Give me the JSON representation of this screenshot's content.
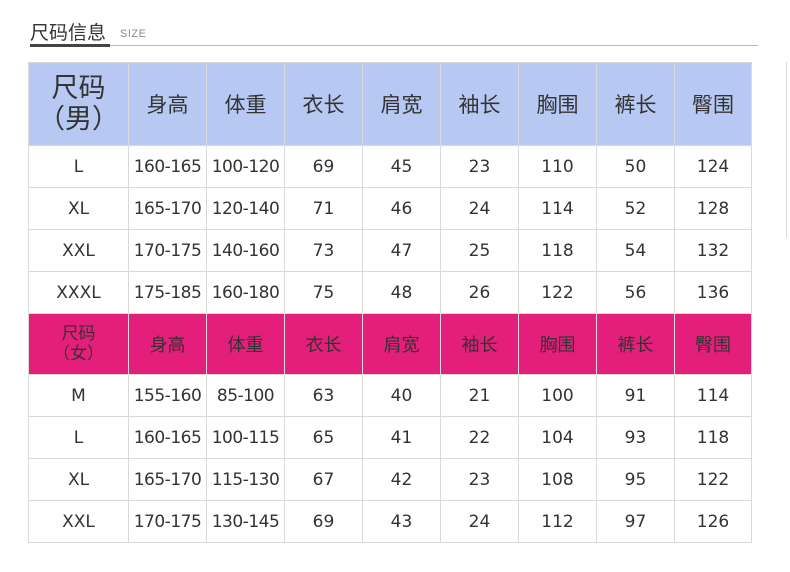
{
  "header": {
    "title": "尺码信息",
    "subtitle": "SIZE"
  },
  "men": {
    "columns": [
      "尺码（男）",
      "身高",
      "体重",
      "衣长",
      "肩宽",
      "袖长",
      "胸围",
      "裤长",
      "臀围"
    ],
    "size_label_line1": "尺码",
    "size_label_line2": "（男）",
    "rows": [
      [
        "L",
        "160-165",
        "100-120",
        "69",
        "45",
        "23",
        "110",
        "50",
        "124"
      ],
      [
        "XL",
        "165-170",
        "120-140",
        "71",
        "46",
        "24",
        "114",
        "52",
        "128"
      ],
      [
        "XXL",
        "170-175",
        "140-160",
        "73",
        "47",
        "25",
        "118",
        "54",
        "132"
      ],
      [
        "XXXL",
        "175-185",
        "160-180",
        "75",
        "48",
        "26",
        "122",
        "56",
        "136"
      ]
    ]
  },
  "women": {
    "columns": [
      "尺码（女）",
      "身高",
      "体重",
      "衣长",
      "肩宽",
      "袖长",
      "胸围",
      "裤长",
      "臀围"
    ],
    "size_label_line1": "尺码",
    "size_label_line2": "（女）",
    "rows": [
      [
        "M",
        "155-160",
        "85-100",
        "63",
        "40",
        "21",
        "100",
        "91",
        "114"
      ],
      [
        "L",
        "160-165",
        "100-115",
        "65",
        "41",
        "22",
        "104",
        "93",
        "118"
      ],
      [
        "XL",
        "165-170",
        "115-130",
        "67",
        "42",
        "23",
        "108",
        "95",
        "122"
      ],
      [
        "XXL",
        "170-175",
        "130-145",
        "69",
        "43",
        "24",
        "112",
        "97",
        "126"
      ]
    ]
  },
  "colors": {
    "men_header_bg": "#b7c8f2",
    "women_header_bg": "#e41f7b",
    "border": "#d9d9d9"
  }
}
